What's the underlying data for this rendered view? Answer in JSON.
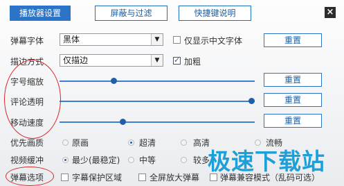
{
  "tabs": [
    {
      "label": "播放器设置",
      "active": true
    },
    {
      "label": "屏蔽与过滤",
      "active": false
    },
    {
      "label": "快捷键说明",
      "active": false
    }
  ],
  "close_glyph": "×",
  "rows": {
    "font": {
      "label": "弹幕字体",
      "value": "黑体",
      "checkbox_label": "仅显示中文字体",
      "checkbox_checked": false,
      "reset": "重置"
    },
    "outline": {
      "label": "描边方式",
      "value": "仅描边",
      "checkbox_label": "加粗",
      "checkbox_checked": true
    },
    "scale": {
      "label": "字号缩放",
      "reset": "重置",
      "level": 0.27
    },
    "opacity": {
      "label": "评论透明",
      "reset": "重置",
      "level": 1.0
    },
    "speed": {
      "label": "移动速度",
      "reset": "重置",
      "level": 0.32
    },
    "quality": {
      "label": "优先画质",
      "options": [
        "原画",
        "超清",
        "高清",
        "流畅"
      ],
      "selected": 1
    },
    "buffer": {
      "label": "视频缓冲",
      "options": [
        "最少(最稳定)",
        "中等",
        "较多"
      ],
      "selected": 0
    },
    "danmaku": {
      "label": "弹幕选项",
      "options": [
        "字幕保护区域",
        "全屏放大弹幕",
        "弹幕兼容模式（乱码可选）"
      ]
    }
  },
  "watermark": "极速下载站",
  "colors": {
    "accent": "#2b74c7",
    "annotation": "#d8262b",
    "watermark": "#1d9fd8"
  }
}
